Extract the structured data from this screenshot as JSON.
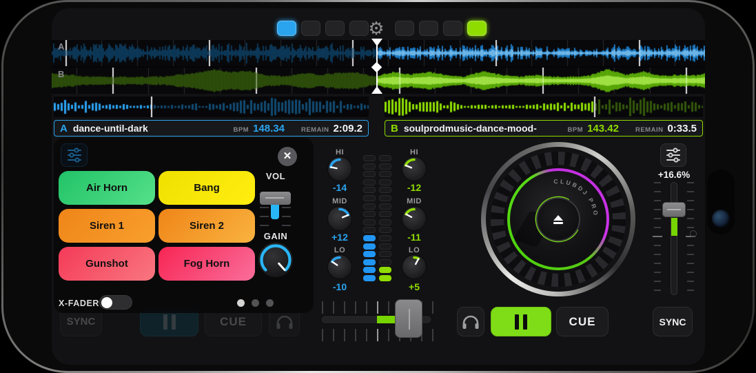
{
  "colors": {
    "accent_a": "#2aa4ef",
    "accent_b": "#8fdc00",
    "vu_a": "#2196f3",
    "vu_b": "#8fdc00",
    "gain_arc": "#29b6f6",
    "pause_active": "#7fdd17",
    "xfader_fill": "#76d400"
  },
  "top_bar": {
    "gear_icon": "⚙",
    "left_indicators": [
      {
        "active": true
      },
      {
        "active": false
      },
      {
        "active": false
      },
      {
        "active": false
      }
    ],
    "right_indicators": [
      {
        "active": false
      },
      {
        "active": false
      },
      {
        "active": false
      },
      {
        "active": true
      }
    ]
  },
  "deck_a": {
    "label": "A",
    "title": "dance-until-dark",
    "bpm_label": "BPM",
    "bpm_value": "148.34",
    "remain_label": "REMAIN",
    "remain_value": "2:09.2",
    "accent": "#2aa4ef",
    "progress": 0.31
  },
  "deck_b": {
    "label": "B",
    "title": "soulprodmusic-dance-mood-",
    "bpm_label": "BPM",
    "bpm_value": "143.42",
    "remain_label": "REMAIN",
    "remain_value": "0:33.5",
    "accent": "#8fdc00",
    "progress": 0.66
  },
  "pads_panel": {
    "vol_label": "VOL",
    "gain_label": "GAIN",
    "xfader_label": "X-FADER",
    "xfader_on": true,
    "close_icon": "✕",
    "page_dots": 3,
    "active_dot": 0,
    "pads": [
      {
        "label": "Air Horn",
        "color_start": "#22c268",
        "color_end": "#55e089"
      },
      {
        "label": "Bang",
        "color_start": "#f0e000",
        "color_end": "#ffee10"
      },
      {
        "label": "Siren 1",
        "color_start": "#ef8518",
        "color_end": "#f89f2e"
      },
      {
        "label": "Siren 2",
        "color_start": "#ef8518",
        "color_end": "#f9b340"
      },
      {
        "label": "Gunshot",
        "color_start": "#f43a58",
        "color_end": "#f97780"
      },
      {
        "label": "Fog Horn",
        "color_start": "#f72553",
        "color_end": "#fa6e9b"
      }
    ]
  },
  "mixer": {
    "channel_a": {
      "hi_label": "HI",
      "hi": "-14",
      "mid_label": "MID",
      "mid": "+12",
      "lo_label": "LO",
      "lo": "-10"
    },
    "channel_b": {
      "hi_label": "HI",
      "hi": "-12",
      "mid_label": "MID",
      "mid": "-11",
      "lo_label": "LO",
      "lo": "+5"
    },
    "vu": {
      "segments": 16,
      "lit_a": 6,
      "lit_b": 2
    }
  },
  "transport_a": {
    "sync_label": "SYNC",
    "cue_label": "CUE"
  },
  "transport_b": {
    "sync_label": "SYNC",
    "cue_label": "CUE"
  },
  "pitch_b": {
    "value": "+16.6%"
  },
  "platter_text": "CLUBDJ PRO"
}
